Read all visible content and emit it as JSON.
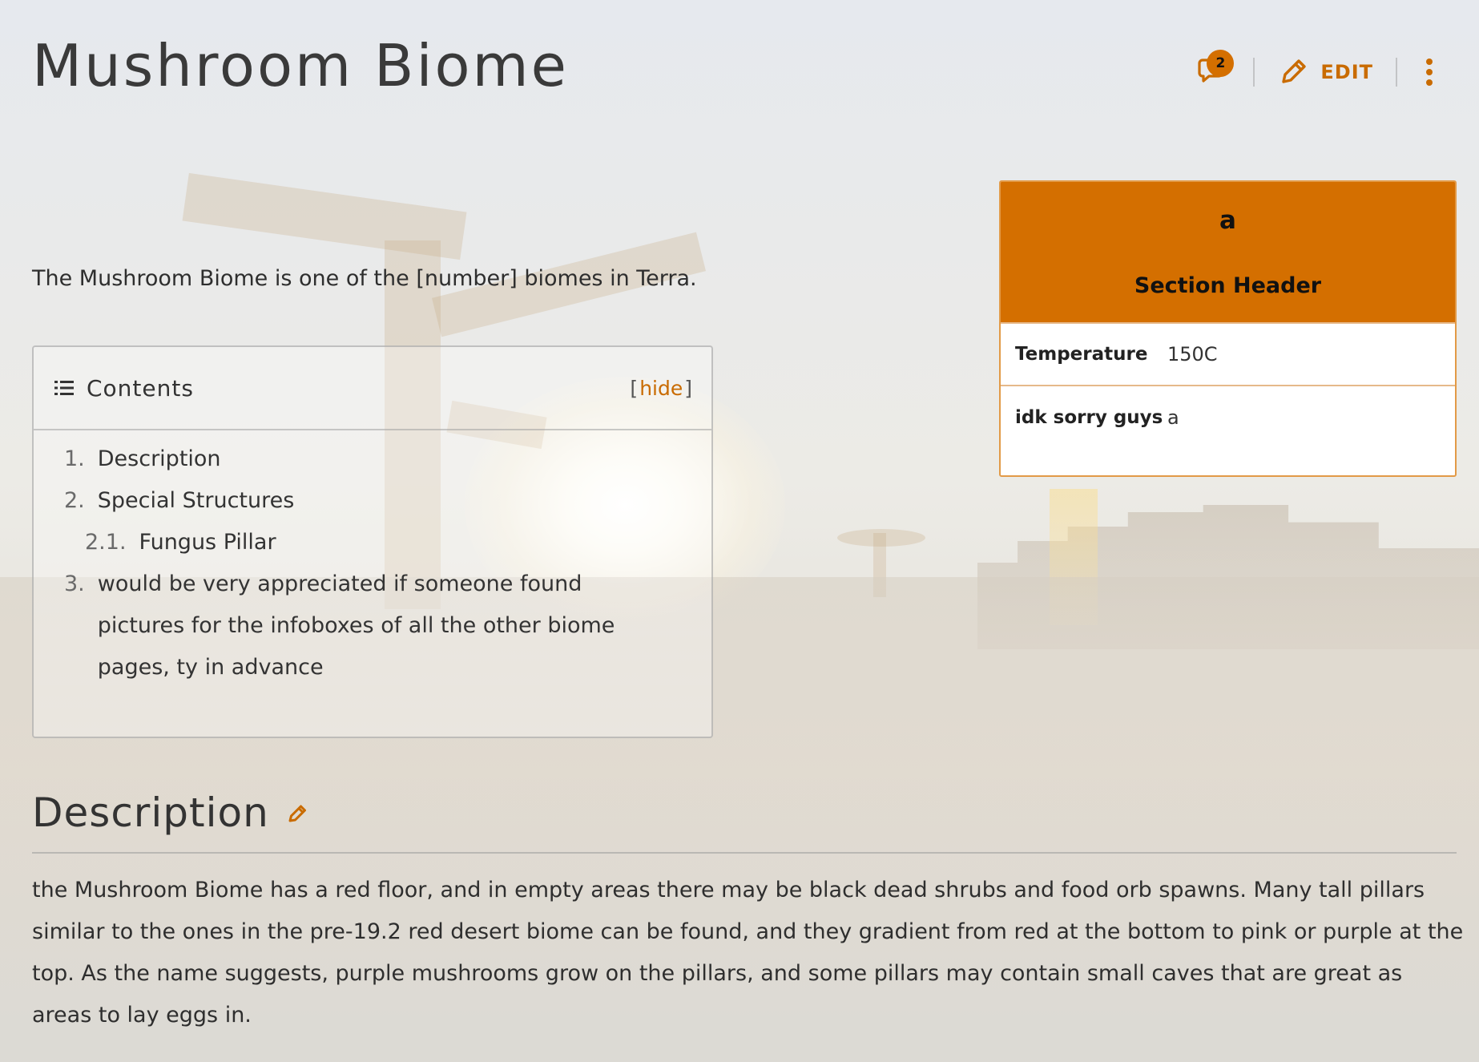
{
  "page": {
    "title": "Mushroom Biome"
  },
  "header_actions": {
    "talk_count": "2",
    "edit_label": "EDIT",
    "accent_color": "#d46f00"
  },
  "intro": "The Mushroom Biome is one of the [number] biomes in Terra.",
  "toc": {
    "title": "Contents",
    "toggle_open": "[",
    "toggle_label": "hide",
    "toggle_close": "]",
    "items": [
      {
        "num": "1.",
        "label": "Description"
      },
      {
        "num": "2.",
        "label": "Special Structures"
      },
      {
        "num": "2.1.",
        "label": "Fungus Pillar"
      },
      {
        "num": "3.",
        "label": "would be very appreciated if someone found pictures for the infoboxes of all the other biome pages, ty in advance"
      }
    ]
  },
  "infobox": {
    "title": "a",
    "section_header": "Section Header",
    "rows": [
      {
        "label": "Temperature",
        "value": "150C"
      },
      {
        "label": "idk sorry guys",
        "value": "a"
      }
    ]
  },
  "description": {
    "heading": "Description",
    "text": "the Mushroom Biome has a red floor, and in empty areas there may be black dead shrubs and food orb spawns. Many tall pillars similar to the ones in the pre-19.2 red desert biome can be found, and they gradient from red at the bottom to pink or purple at the top. As the name suggests, purple mushrooms grow on the pillars, and some pillars may contain small caves that are great as areas to lay eggs in."
  },
  "icons": {
    "talk": "speech-bubble-icon",
    "edit": "pencil-icon",
    "more": "vertical-ellipsis-icon",
    "toc": "list-icon",
    "section_edit": "pencil-icon"
  }
}
